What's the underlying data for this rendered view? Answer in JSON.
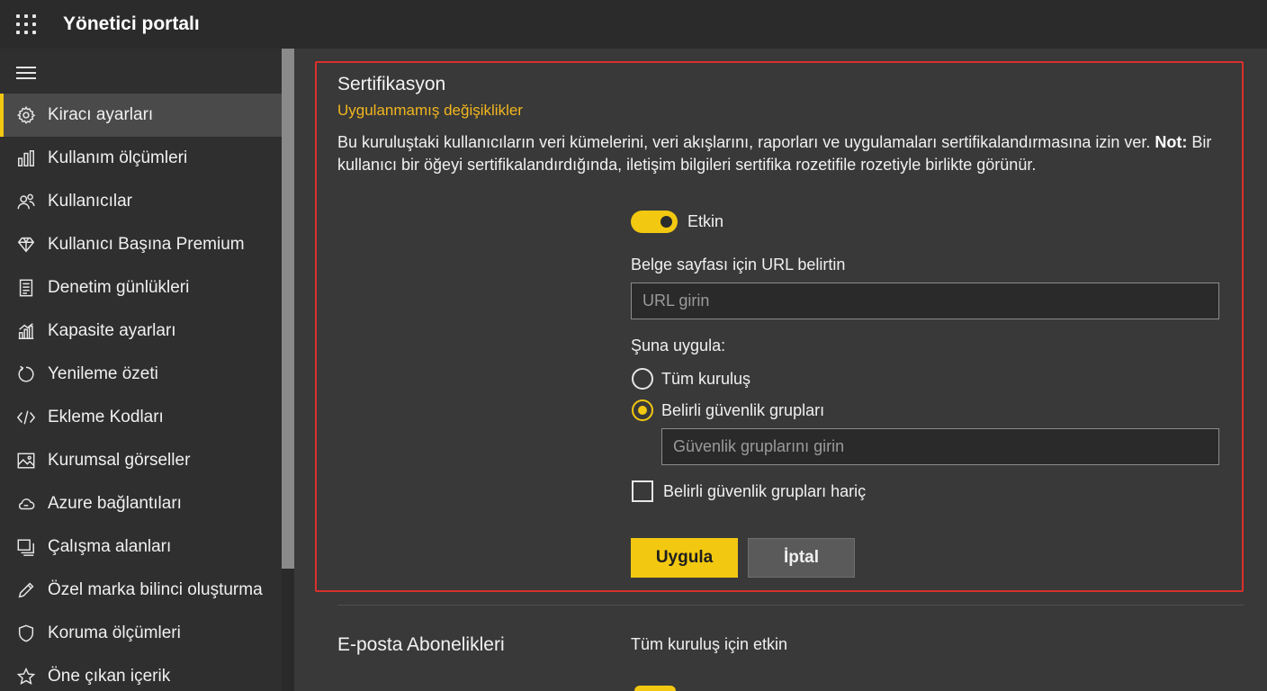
{
  "header": {
    "title": "Yönetici portalı",
    "launcher_icon": "waffle-icon"
  },
  "sidebar": {
    "menu_icon": "hamburger-icon",
    "items": [
      {
        "label": "Kiracı ayarları",
        "icon": "gear-icon",
        "active": true
      },
      {
        "label": "Kullanım ölçümleri",
        "icon": "bar-chart-icon"
      },
      {
        "label": "Kullanıcılar",
        "icon": "users-icon"
      },
      {
        "label": "Kullanıcı Başına Premium",
        "icon": "diamond-icon"
      },
      {
        "label": "Denetim günlükleri",
        "icon": "document-icon"
      },
      {
        "label": "Kapasite ayarları",
        "icon": "capacity-icon"
      },
      {
        "label": "Yenileme özeti",
        "icon": "refresh-icon"
      },
      {
        "label": "Ekleme Kodları",
        "icon": "code-icon"
      },
      {
        "label": "Kurumsal görseller",
        "icon": "image-icon"
      },
      {
        "label": "Azure bağlantıları",
        "icon": "cloud-link-icon"
      },
      {
        "label": "Çalışma alanları",
        "icon": "workspaces-icon"
      },
      {
        "label": "Özel marka bilinci oluşturma",
        "icon": "pencil-icon"
      },
      {
        "label": "Koruma ölçümleri",
        "icon": "shield-icon"
      },
      {
        "label": "Öne çıkan içerik",
        "icon": "star-icon"
      }
    ]
  },
  "certification": {
    "title": "Sertifikasyon",
    "unapplied": "Uygulanmamış değişiklikler",
    "description_part1": "Bu kuruluştaki kullanıcıların veri kümelerini, veri akışlarını, raporları ve uygulamaları sertifikalandırmasına izin ver. ",
    "description_bold": "Not:",
    "description_part2": " Bir kullanıcı bir öğeyi sertifikalandırdığında, iletişim bilgileri sertifika rozetifile rozetiyle birlikte görünür.",
    "toggle_label": "Etkin",
    "toggle_on": true,
    "url_label": "Belge sayfası için URL belirtin",
    "url_placeholder": "URL girin",
    "url_value": "",
    "apply_to_label": "Şuna uygula:",
    "radio_all": "Tüm kuruluş",
    "radio_specific": "Belirli güvenlik grupları",
    "selected_option": "Belirli güvenlik grupları",
    "groups_placeholder": "Güvenlik gruplarını girin",
    "except_label": "Belirli güvenlik grupları hariç",
    "except_checked": false,
    "apply_button": "Uygula",
    "cancel_button": "İptal"
  },
  "email_subscriptions": {
    "title": "E-posta Abonelikleri",
    "status": "Tüm kuruluş için etkin"
  },
  "colors": {
    "accent": "#f2c811",
    "warning_text": "#f2b61e",
    "highlight_border": "#d9302c",
    "background": "#393939",
    "sidebar": "#2f2f2f",
    "header": "#2b2b2b"
  }
}
